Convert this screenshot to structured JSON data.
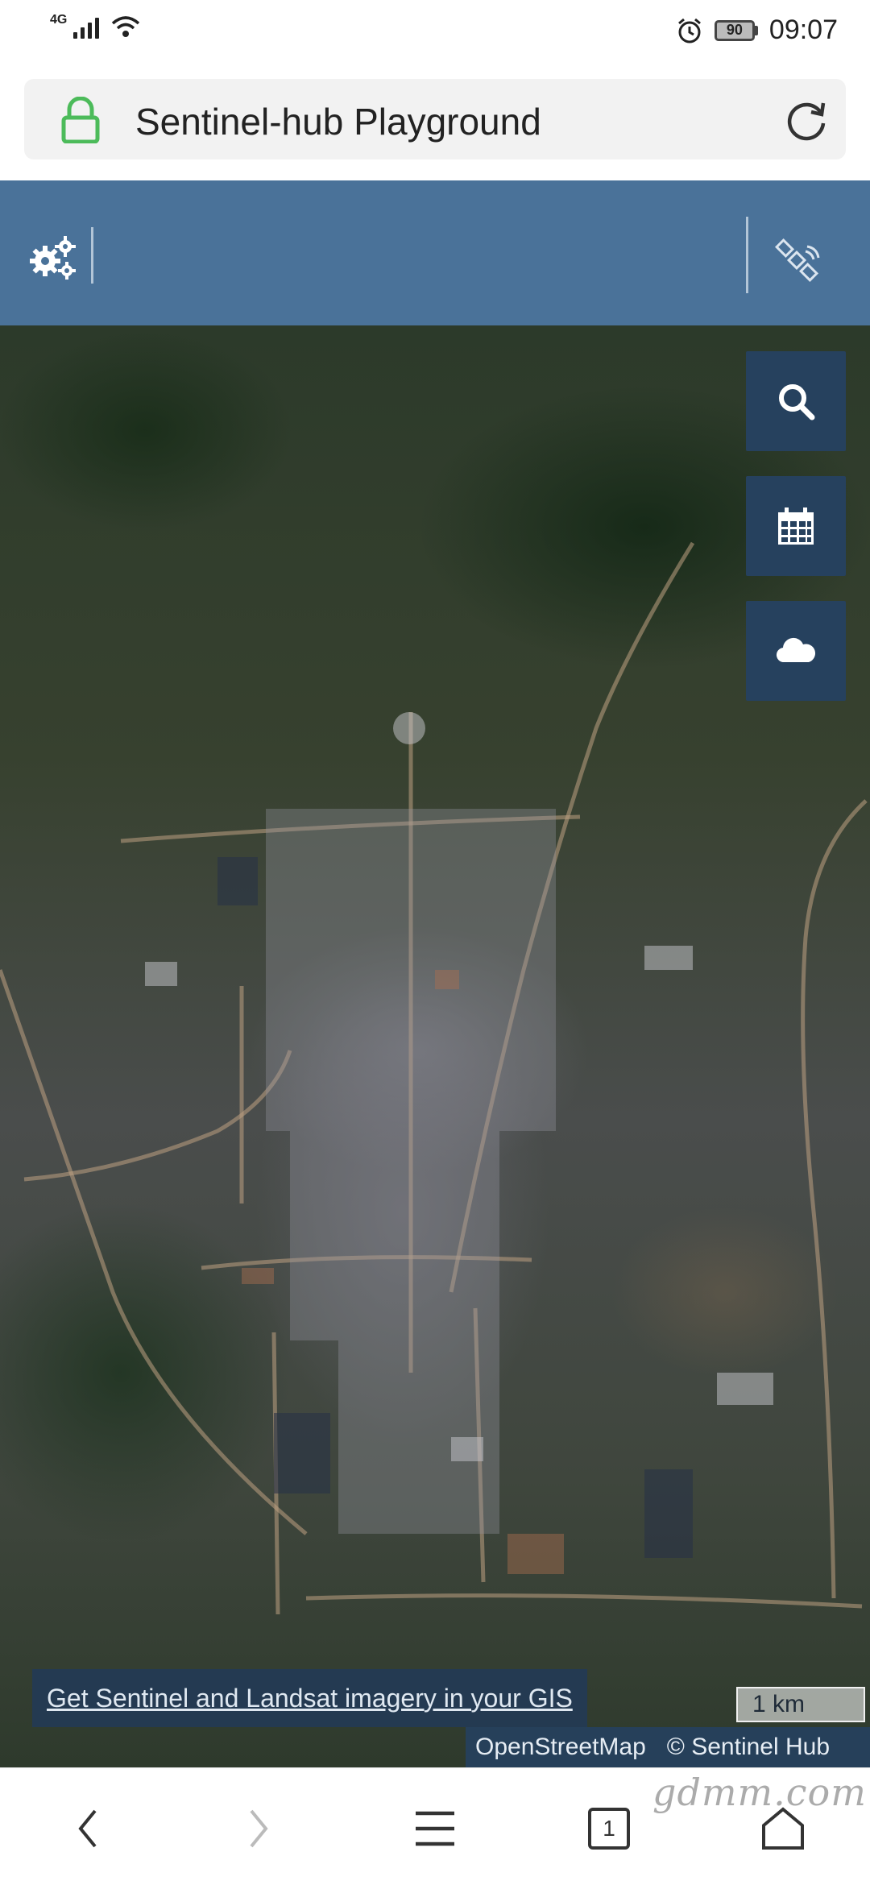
{
  "status_bar": {
    "network": "4G",
    "battery": "90",
    "time": "09:07"
  },
  "url_bar": {
    "title": "Sentinel-hub Playground"
  },
  "map": {
    "gis_link": "Get Sentinel and Landsat imagery in your GIS",
    "scale": "1 km",
    "attribution_osm": "OpenStreetMap",
    "attribution_sentinel": "© Sentinel Hub"
  },
  "bottom_nav": {
    "tab_count": "1"
  },
  "watermark": "gdmm.com",
  "colors": {
    "header": "#4a7299",
    "map_button": "#26415e",
    "lock_green": "#4cbb5a"
  },
  "icons": [
    "signal-icon",
    "wifi-icon",
    "alarm-icon",
    "battery-icon",
    "lock-icon",
    "reload-icon",
    "settings-icon",
    "satellite-icon",
    "search-icon",
    "calendar-icon",
    "cloud-icon",
    "back-icon",
    "forward-icon",
    "menu-icon",
    "tabs-icon",
    "home-icon"
  ]
}
